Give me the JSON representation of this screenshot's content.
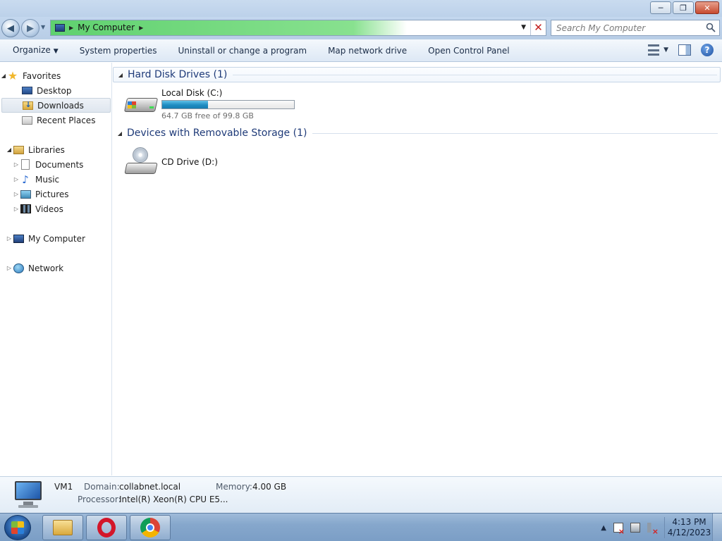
{
  "window": {
    "minimize_label": "─",
    "maximize_label": "❐",
    "close_label": "✕"
  },
  "address": {
    "location": "My Computer",
    "progress_fraction": 0.72
  },
  "search": {
    "placeholder": "Search My Computer"
  },
  "toolbar": {
    "organize": "Organize",
    "system_properties": "System properties",
    "uninstall": "Uninstall or change a program",
    "map_network_drive": "Map network drive",
    "open_control_panel": "Open Control Panel",
    "help_label": "?"
  },
  "sidebar": {
    "favorites": "Favorites",
    "desktop": "Desktop",
    "downloads": "Downloads",
    "recent_places": "Recent Places",
    "libraries": "Libraries",
    "documents": "Documents",
    "music": "Music",
    "pictures": "Pictures",
    "videos": "Videos",
    "my_computer": "My Computer",
    "network": "Network",
    "selected": "Downloads"
  },
  "content": {
    "groups": [
      {
        "label": "Hard Disk Drives (1)",
        "items": [
          {
            "name": "Local Disk (C:)",
            "free_text": "64.7 GB free of 99.8 GB",
            "used_fraction": 0.35,
            "icon": "hard-drive-icon"
          }
        ]
      },
      {
        "label": "Devices with Removable Storage (1)",
        "items": [
          {
            "name": "CD Drive (D:)",
            "icon": "cd-drive-icon"
          }
        ]
      }
    ]
  },
  "details": {
    "computer_name": "VM1",
    "domain_label": "Domain:",
    "domain_value": "collabnet.local",
    "memory_label": "Memory:",
    "memory_value": "4.00 GB",
    "processor_label": "Processor:",
    "processor_value": "Intel(R) Xeon(R) CPU E5..."
  },
  "taskbar": {
    "pinned": [
      "windows-explorer",
      "opera",
      "chrome"
    ],
    "tray_arrow": "▲",
    "time": "4:13 PM",
    "date": "4/12/2023"
  },
  "colors": {
    "accent_blue": "#1e3a78",
    "progress_green": "#5fd16f",
    "usage_blue": "#1e8cc2"
  }
}
